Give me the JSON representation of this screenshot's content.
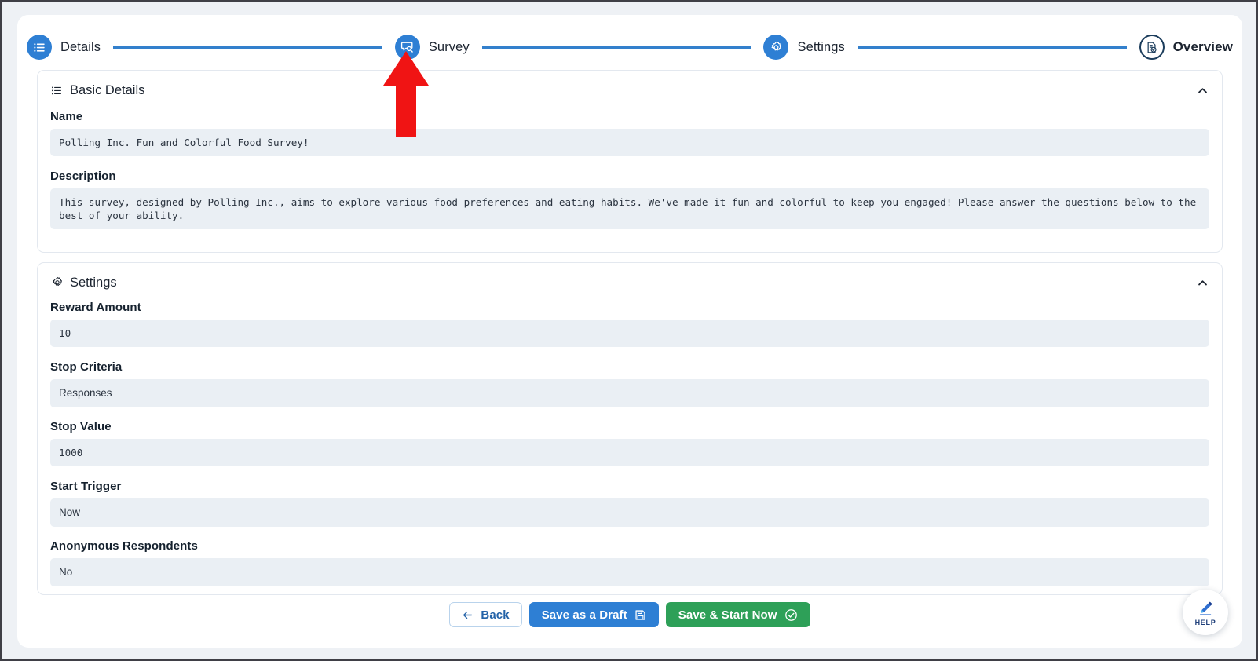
{
  "stepper": {
    "steps": [
      {
        "label": "Details",
        "icon": "list-icon",
        "state": "done"
      },
      {
        "label": "Survey",
        "icon": "survey-search-icon",
        "state": "done"
      },
      {
        "label": "Settings",
        "icon": "gear-icon",
        "state": "done"
      },
      {
        "label": "Overview",
        "icon": "document-check-icon",
        "state": "active"
      }
    ],
    "accent_color": "#2e7fd4",
    "connector_color": "#3380cc",
    "active_border_color": "#1c3d5c"
  },
  "basic_details": {
    "title": "Basic Details",
    "icon": "list-bullets-icon",
    "collapse_icon": "chevron-up-icon",
    "fields": [
      {
        "label": "Name",
        "value": "Polling Inc. Fun and Colorful Food Survey!"
      },
      {
        "label": "Description",
        "value": "This survey, designed by Polling Inc., aims to explore various food preferences and eating habits. We've made it fun and colorful to keep you engaged! Please answer the questions below to the best of your ability."
      }
    ]
  },
  "settings": {
    "title": "Settings",
    "icon": "gear-icon",
    "collapse_icon": "chevron-up-icon",
    "fields": [
      {
        "label": "Reward Amount",
        "value": "10"
      },
      {
        "label": "Stop Criteria",
        "value": "Responses"
      },
      {
        "label": "Stop Value",
        "value": "1000"
      },
      {
        "label": "Start Trigger",
        "value": "Now"
      },
      {
        "label": "Anonymous Respondents",
        "value": "No"
      }
    ]
  },
  "buttons": {
    "back": {
      "label": "Back",
      "icon": "arrow-left-icon",
      "color": "#2463a8"
    },
    "draft": {
      "label": "Save as a Draft",
      "icon": "floppy-disk-icon",
      "color": "#2e7fd4"
    },
    "start": {
      "label": "Save & Start Now",
      "icon": "check-circle-icon",
      "color": "#2ea058"
    }
  },
  "help": {
    "label": "HELP",
    "icon": "pen-icon"
  },
  "annotation": {
    "type": "red-arrow-up",
    "color": "#f01414",
    "points_at": "Survey"
  }
}
